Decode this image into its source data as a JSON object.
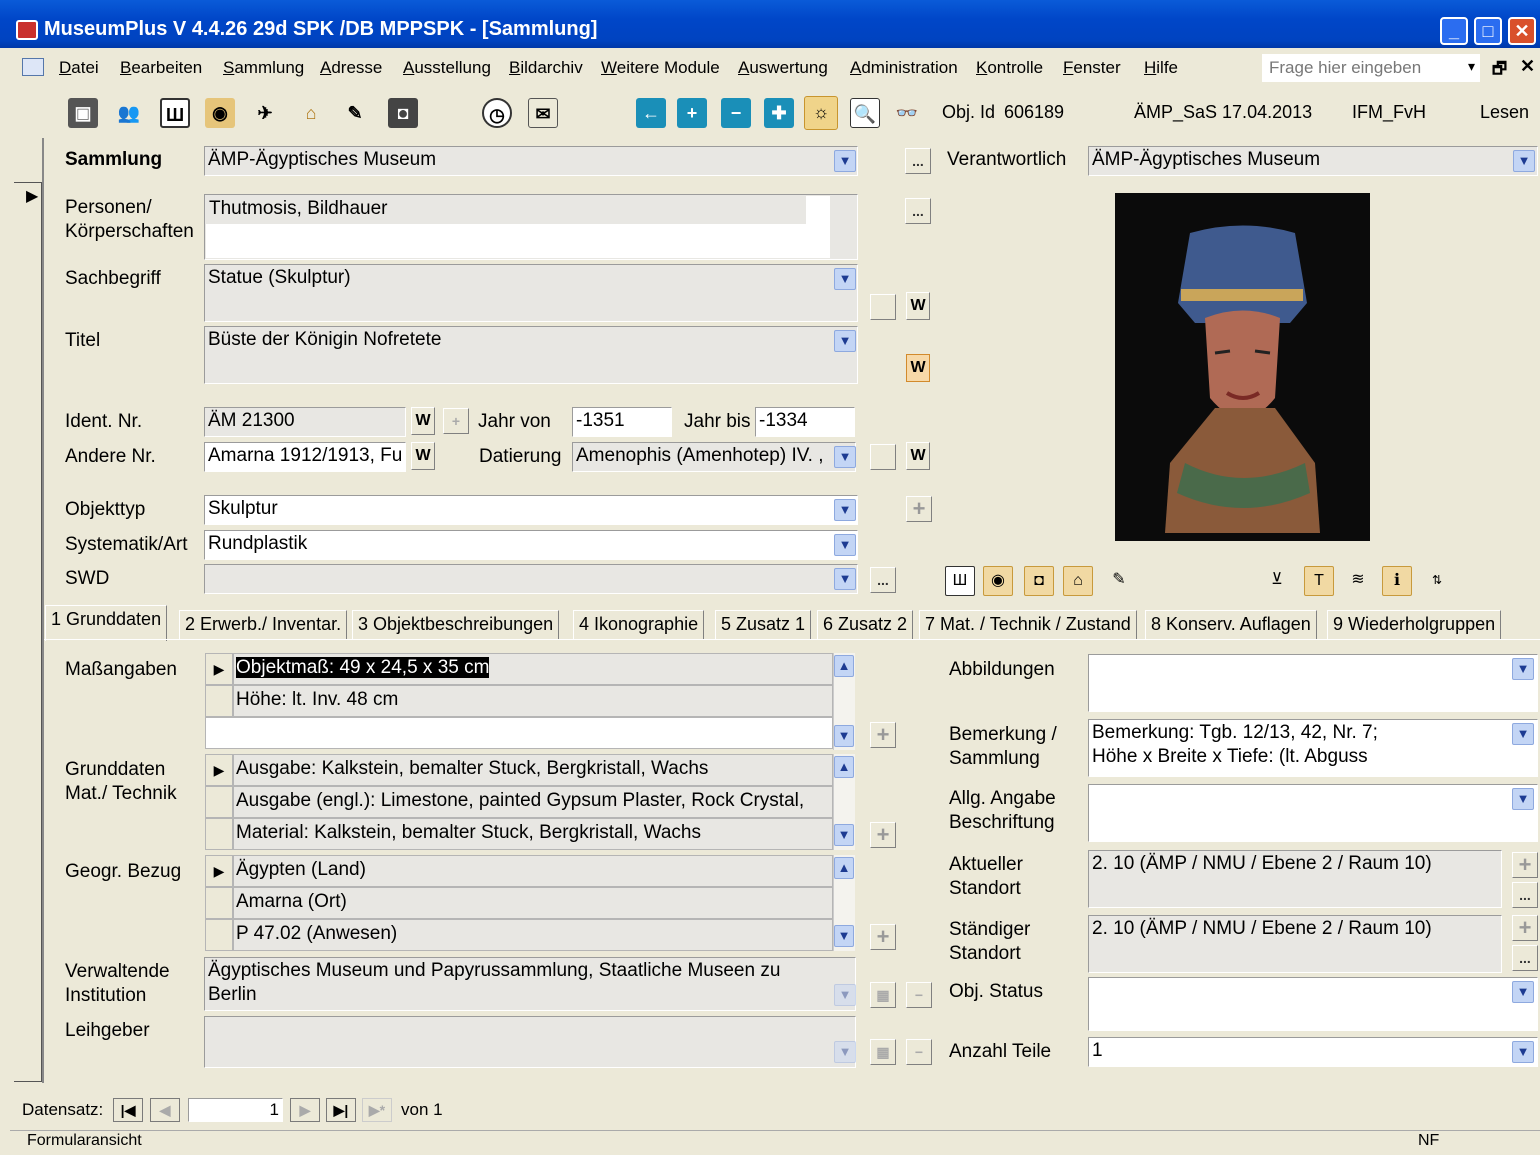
{
  "window": {
    "title": "MuseumPlus V 4.4.26 29d SPK /DB MPPSPK - [Sammlung]"
  },
  "menu": {
    "items": [
      "Datei",
      "Bearbeiten",
      "Sammlung",
      "Adresse",
      "Ausstellung",
      "Bildarchiv",
      "Weitere Module",
      "Auswertung",
      "Administration",
      "Kontrolle",
      "Fenster",
      "Hilfe"
    ],
    "ask_placeholder": "Frage hier eingeben"
  },
  "toolbar": {
    "obj_id_label": "Obj. Id",
    "obj_id": "606189",
    "user_date": "ÄMP_SaS 17.04.2013",
    "user": "IFM_FvH",
    "mode": "Lesen"
  },
  "header": {
    "sammlung_label": "Sammlung",
    "sammlung_value": "ÄMP-Ägyptisches Museum",
    "verantwortlich_label": "Verantwortlich",
    "verantwortlich_value": "ÄMP-Ägyptisches Museum"
  },
  "form": {
    "personen_label": "Personen/",
    "personen_label2": "Körperschaften",
    "personen_value": "Thutmosis, Bildhauer",
    "sachbegriff_label": "Sachbegriff",
    "sachbegriff_value": "Statue (Skulptur)",
    "titel_label": "Titel",
    "titel_value": "Büste der Königin Nofretete",
    "ident_label": "Ident. Nr.",
    "ident_value": "ÄM 21300",
    "jahr_von_label": "Jahr von",
    "jahr_von_value": "-1351",
    "jahr_bis_label": "Jahr bis",
    "jahr_bis_value": "-1334",
    "andere_label": "Andere Nr.",
    "andere_value": "Amarna 1912/1913, Fu",
    "datierung_label": "Datierung",
    "datierung_value": "Amenophis (Amenhotep) IV. ,",
    "objekttyp_label": "Objekttyp",
    "objekttyp_value": "Skulptur",
    "systematik_label": "Systematik/Art",
    "systematik_value": "Rundplastik",
    "swd_label": "SWD",
    "swd_value": "",
    "w_label": "W",
    "dots_label": "..."
  },
  "tabs": [
    "1 Grunddaten",
    "2 Erwerb./ Inventar.",
    "3 Objektbeschreibungen",
    "4 Ikonographie",
    "5 Zusatz 1",
    "6 Zusatz 2",
    "7 Mat. / Technik / Zustand",
    "8 Konserv. Auflagen",
    "9 Wiederholgruppen"
  ],
  "grunddaten": {
    "masse_label": "Maßangaben",
    "masse_rows": [
      "Objektmaß: 49 x 24,5 x 35 cm",
      "Höhe: lt. Inv. 48 cm",
      ""
    ],
    "mat_label": "Grunddaten",
    "mat_label2": "Mat./ Technik",
    "mat_rows": [
      "Ausgabe: Kalkstein, bemalter Stuck, Bergkristall, Wachs",
      "Ausgabe (engl.): Limestone, painted Gypsum Plaster, Rock Crystal,",
      "Material: Kalkstein, bemalter Stuck, Bergkristall, Wachs"
    ],
    "geo_label": "Geogr. Bezug",
    "geo_rows": [
      "Ägypten (Land)",
      "Amarna (Ort)",
      "P 47.02 (Anwesen)"
    ],
    "inst_label": "Verwaltende",
    "inst_label2": "Institution",
    "inst_value": "Ägyptisches Museum und Papyrussammlung, Staatliche Museen zu",
    "inst_value2": "Berlin",
    "leih_label": "Leihgeber",
    "leih_value": "",
    "abb_label": "Abbildungen",
    "bem_label": "Bemerkung /",
    "bem_label2": "Sammlung",
    "bem_value": "Bemerkung: Tgb. 12/13, 42, Nr. 7;",
    "bem_value2": "Höhe x Breite x Tiefe: (lt. Abguss",
    "allg_label": "Allg. Angabe",
    "allg_label2": "Beschriftung",
    "akt_label": "Aktueller",
    "akt_label2": "Standort",
    "akt_value": "2. 10 (ÄMP / NMU / Ebene 2 / Raum 10)",
    "staend_label": "Ständiger",
    "staend_label2": "Standort",
    "staend_value": "2. 10 (ÄMP / NMU / Ebene 2 / Raum 10)",
    "status_label": "Obj. Status",
    "status_value": "",
    "teile_label": "Anzahl Teile",
    "teile_value": "1"
  },
  "nav": {
    "label": "Datensatz:",
    "current": "1",
    "of": "von 1"
  },
  "status": {
    "text": "Formularansicht",
    "nf": "NF"
  }
}
